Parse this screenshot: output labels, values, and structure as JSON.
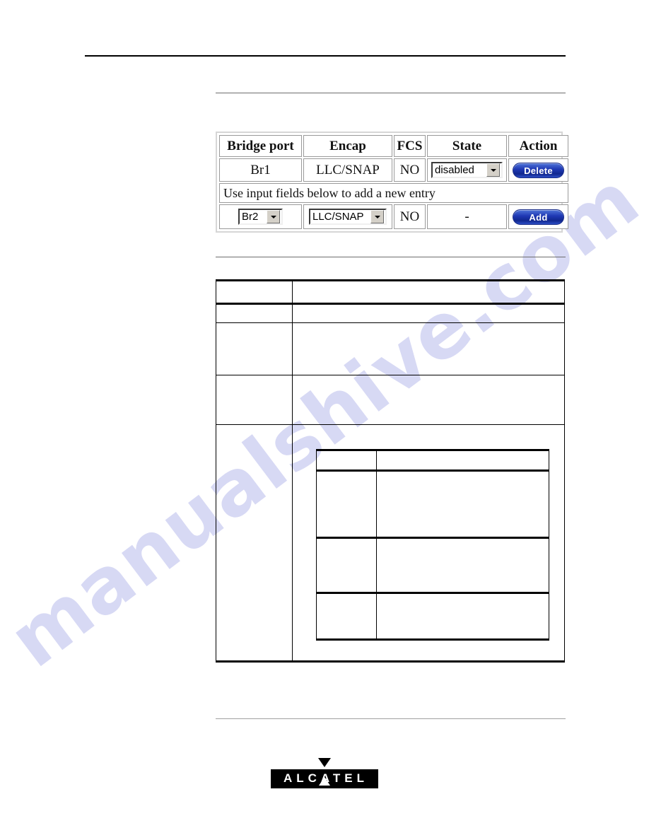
{
  "watermark": {
    "text": "manualshive.com",
    "color": "#c9cbf0"
  },
  "screenshot": {
    "name": "bridge-port-encapsulation-table",
    "columns": [
      "Bridge port",
      "Encap",
      "FCS",
      "State",
      "Action"
    ],
    "rows": [
      {
        "bridge_port": "Br1",
        "encap": "LLC/SNAP",
        "fcs": "NO",
        "state": "disabled",
        "action": "Delete"
      }
    ],
    "note_row": "Use input fields below to add a new entry",
    "input_row": {
      "bridge_port": "Br2",
      "encap": "LLC/SNAP",
      "fcs": "NO",
      "state": "-",
      "action": "Add"
    },
    "colors": {
      "button_blue": "#1f38b4",
      "button_text": "#ffffff",
      "cell_border": "#9a9a9a",
      "frame": "#d6d6d6"
    }
  },
  "description_table": {
    "rows": [
      {
        "label": "",
        "text": ""
      },
      {
        "label": "",
        "text": ""
      },
      {
        "label": "",
        "text": ""
      },
      {
        "label": "",
        "text": ""
      },
      {
        "label": "",
        "text": ""
      }
    ]
  },
  "inner_table": {
    "rows": [
      {
        "label": "",
        "text": ""
      },
      {
        "label": "",
        "text": ""
      },
      {
        "label": "",
        "text": ""
      },
      {
        "label": "",
        "text": ""
      }
    ]
  },
  "footer": {
    "logo_text": "ALCATEL"
  }
}
